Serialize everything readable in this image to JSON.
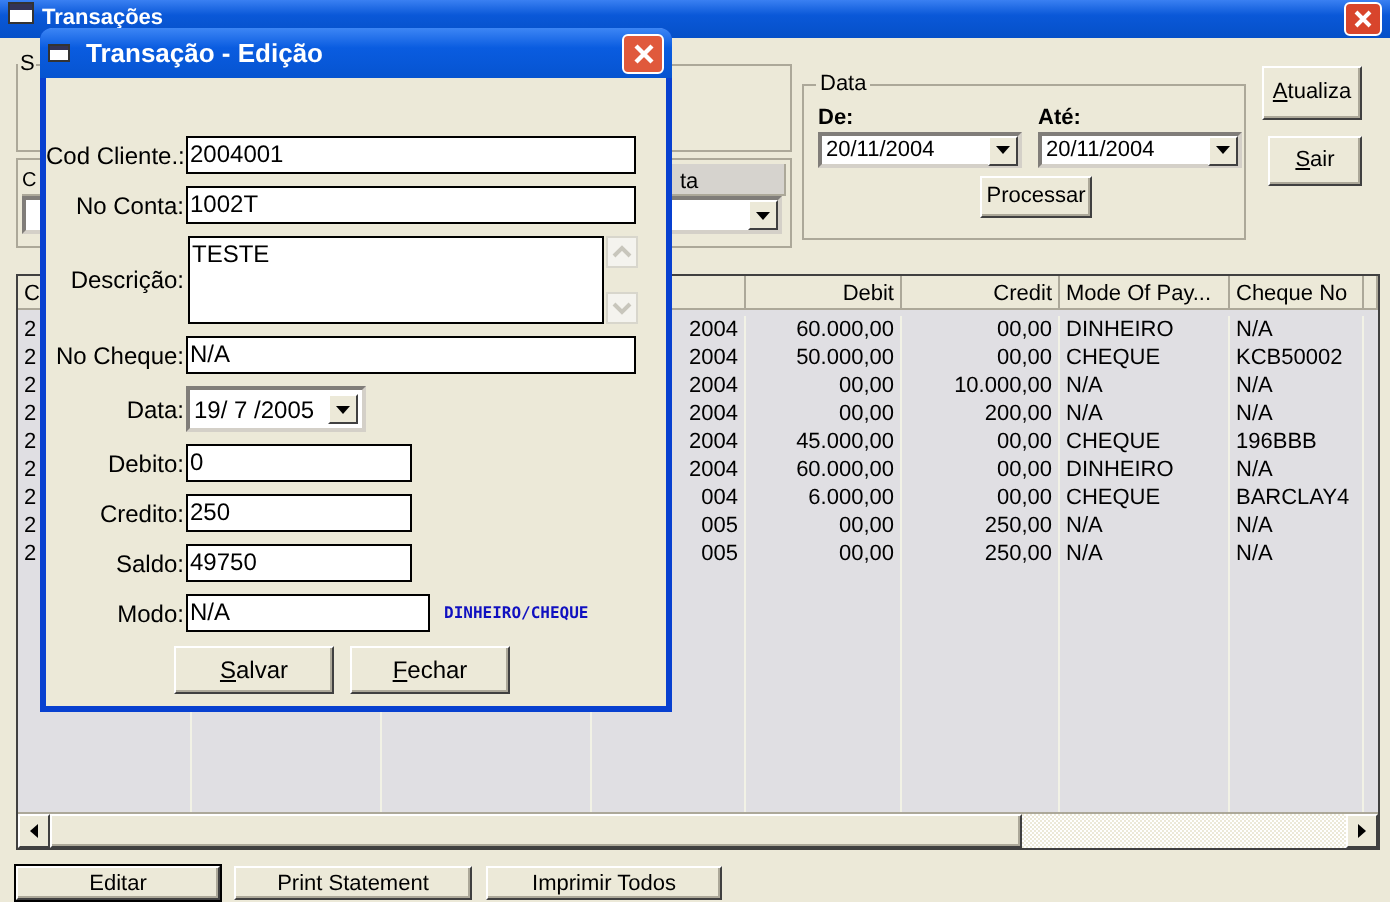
{
  "window": {
    "title": "Transações"
  },
  "filter_group": {
    "label": "S"
  },
  "account_panel": {
    "column_1": "C",
    "column_2": "ta"
  },
  "date_group": {
    "title": "Data",
    "from_label": "De:",
    "from_value": "20/11/2004",
    "to_label": "Até:",
    "to_value": "20/11/2004",
    "process_button": "Processar"
  },
  "side_buttons": [
    {
      "label": "Atualiza",
      "access_key": true
    },
    {
      "label": "Sair",
      "access_key": true
    }
  ],
  "grid": {
    "columns": [
      {
        "kind": "text",
        "label": "C"
      },
      {
        "kind": "covered"
      },
      {
        "kind": "covered"
      },
      {
        "kind": "covered"
      },
      {
        "kind": "number",
        "label": "Debit"
      },
      {
        "kind": "number",
        "label": "Credit"
      },
      {
        "kind": "text",
        "label": "Mode Of Pay..."
      },
      {
        "kind": "text",
        "label": "Cheque No"
      }
    ],
    "rows": [
      {
        "column_1": "2",
        "column_4": "2004",
        "debit": "60.000,00",
        "credit": "00,00",
        "mode": "DINHEIRO",
        "cheque": "N/A"
      },
      {
        "column_1": "2",
        "column_4": "2004",
        "debit": "50.000,00",
        "credit": "00,00",
        "mode": "CHEQUE",
        "cheque": "KCB50002"
      },
      {
        "column_1": "2",
        "column_4": "2004",
        "debit": "00,00",
        "credit": "10.000,00",
        "mode": "N/A",
        "cheque": "N/A"
      },
      {
        "column_1": "2",
        "column_4": "2004",
        "debit": "00,00",
        "credit": "200,00",
        "mode": "N/A",
        "cheque": "N/A"
      },
      {
        "column_1": "2",
        "column_4": "2004",
        "debit": "45.000,00",
        "credit": "00,00",
        "mode": "CHEQUE",
        "cheque": "196BBB"
      },
      {
        "column_1": "2",
        "column_4": "2004",
        "debit": "60.000,00",
        "credit": "00,00",
        "mode": "DINHEIRO",
        "cheque": "N/A"
      },
      {
        "column_1": "2",
        "column_4": "004",
        "debit": "6.000,00",
        "credit": "00,00",
        "mode": "CHEQUE",
        "cheque": "BARCLAY4"
      },
      {
        "column_1": "2",
        "column_4": "005",
        "debit": "00,00",
        "credit": "250,00",
        "mode": "N/A",
        "cheque": "N/A"
      },
      {
        "column_1": "2",
        "column_4": "005",
        "debit": "00,00",
        "credit": "250,00",
        "mode": "N/A",
        "cheque": "N/A"
      }
    ]
  },
  "bottom_buttons": [
    {
      "label": "Editar",
      "selected": true
    },
    {
      "label": "Print Statement",
      "selected": false
    },
    {
      "label": "Imprimir Todos",
      "selected": false
    }
  ],
  "dialog": {
    "title": "Transação - Edição",
    "fields": [
      {
        "kind": "text",
        "label": "Cod Cliente.:",
        "value": "2004001"
      },
      {
        "kind": "text",
        "label": "No Conta:",
        "value": "1002T"
      },
      {
        "kind": "memo",
        "label": "Descrição:",
        "value": "TESTE"
      },
      {
        "kind": "text",
        "label": "No Cheque:",
        "value": "N/A"
      },
      {
        "kind": "date",
        "label": "Data:",
        "value": "19/ 7 /2005"
      },
      {
        "kind": "short",
        "label": "Debito:",
        "value": "0"
      },
      {
        "kind": "short",
        "label": "Credito:",
        "value": "250"
      },
      {
        "kind": "short",
        "label": "Saldo:",
        "value": "49750"
      },
      {
        "kind": "mode",
        "label": "Modo:",
        "value": "N/A",
        "hint": "DINHEIRO/CHEQUE"
      }
    ],
    "buttons": [
      {
        "label": "Salvar",
        "access_key": true
      },
      {
        "label": "Fechar",
        "access_key": true
      }
    ]
  }
}
